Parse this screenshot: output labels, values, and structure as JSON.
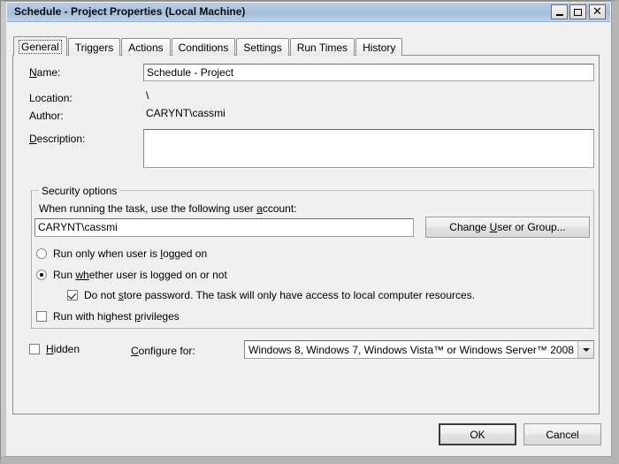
{
  "window": {
    "title": "Schedule - Project Properties (Local Machine)",
    "minimize_label": "",
    "maximize_label": "",
    "close_label": "✕"
  },
  "tabs": [
    {
      "label": "General",
      "active": true
    },
    {
      "label": "Triggers",
      "active": false
    },
    {
      "label": "Actions",
      "active": false
    },
    {
      "label": "Conditions",
      "active": false
    },
    {
      "label": "Settings",
      "active": false
    },
    {
      "label": "Run Times",
      "active": false
    },
    {
      "label": "History",
      "active": false
    }
  ],
  "general": {
    "name_label_pre": "",
    "name_label_acc": "N",
    "name_label_post": "ame:",
    "name_value": "Schedule - Project",
    "location_label": "Location:",
    "location_value": "\\",
    "author_label": "Author:",
    "author_value": "CARYNT\\cassmi",
    "description_label_acc": "D",
    "description_label_post": "escription:",
    "description_value": ""
  },
  "security": {
    "group_title": "Security options",
    "account_label_pre": "When running the task, use the following user ",
    "account_label_acc": "a",
    "account_label_post": "ccount:",
    "account_value": "CARYNT\\cassmi",
    "change_user_pre": "Change ",
    "change_user_acc": "U",
    "change_user_post": "ser or Group...",
    "radio_logged_on": {
      "pre": "Run only when user is ",
      "acc": "l",
      "post": "ogged on",
      "selected": false
    },
    "radio_whether": {
      "pre": "Run ",
      "acc": "wh",
      "post": "ether user is logged on or not",
      "selected": true
    },
    "check_no_store": {
      "pre": "Do not ",
      "acc": "s",
      "post": "tore password. The task will only have access to local computer resources.",
      "checked": true
    },
    "check_highest": {
      "pre": "Run with highest ",
      "acc": "p",
      "post": "rivileges",
      "checked": false
    }
  },
  "footer_options": {
    "hidden_acc": "H",
    "hidden_post": "idden",
    "hidden_checked": false,
    "configure_acc": "C",
    "configure_post": "onfigure for:",
    "configure_value": "Windows 8, Windows 7, Windows Vista™ or Windows Server™ 2008"
  },
  "buttons": {
    "ok": "OK",
    "cancel": "Cancel"
  }
}
